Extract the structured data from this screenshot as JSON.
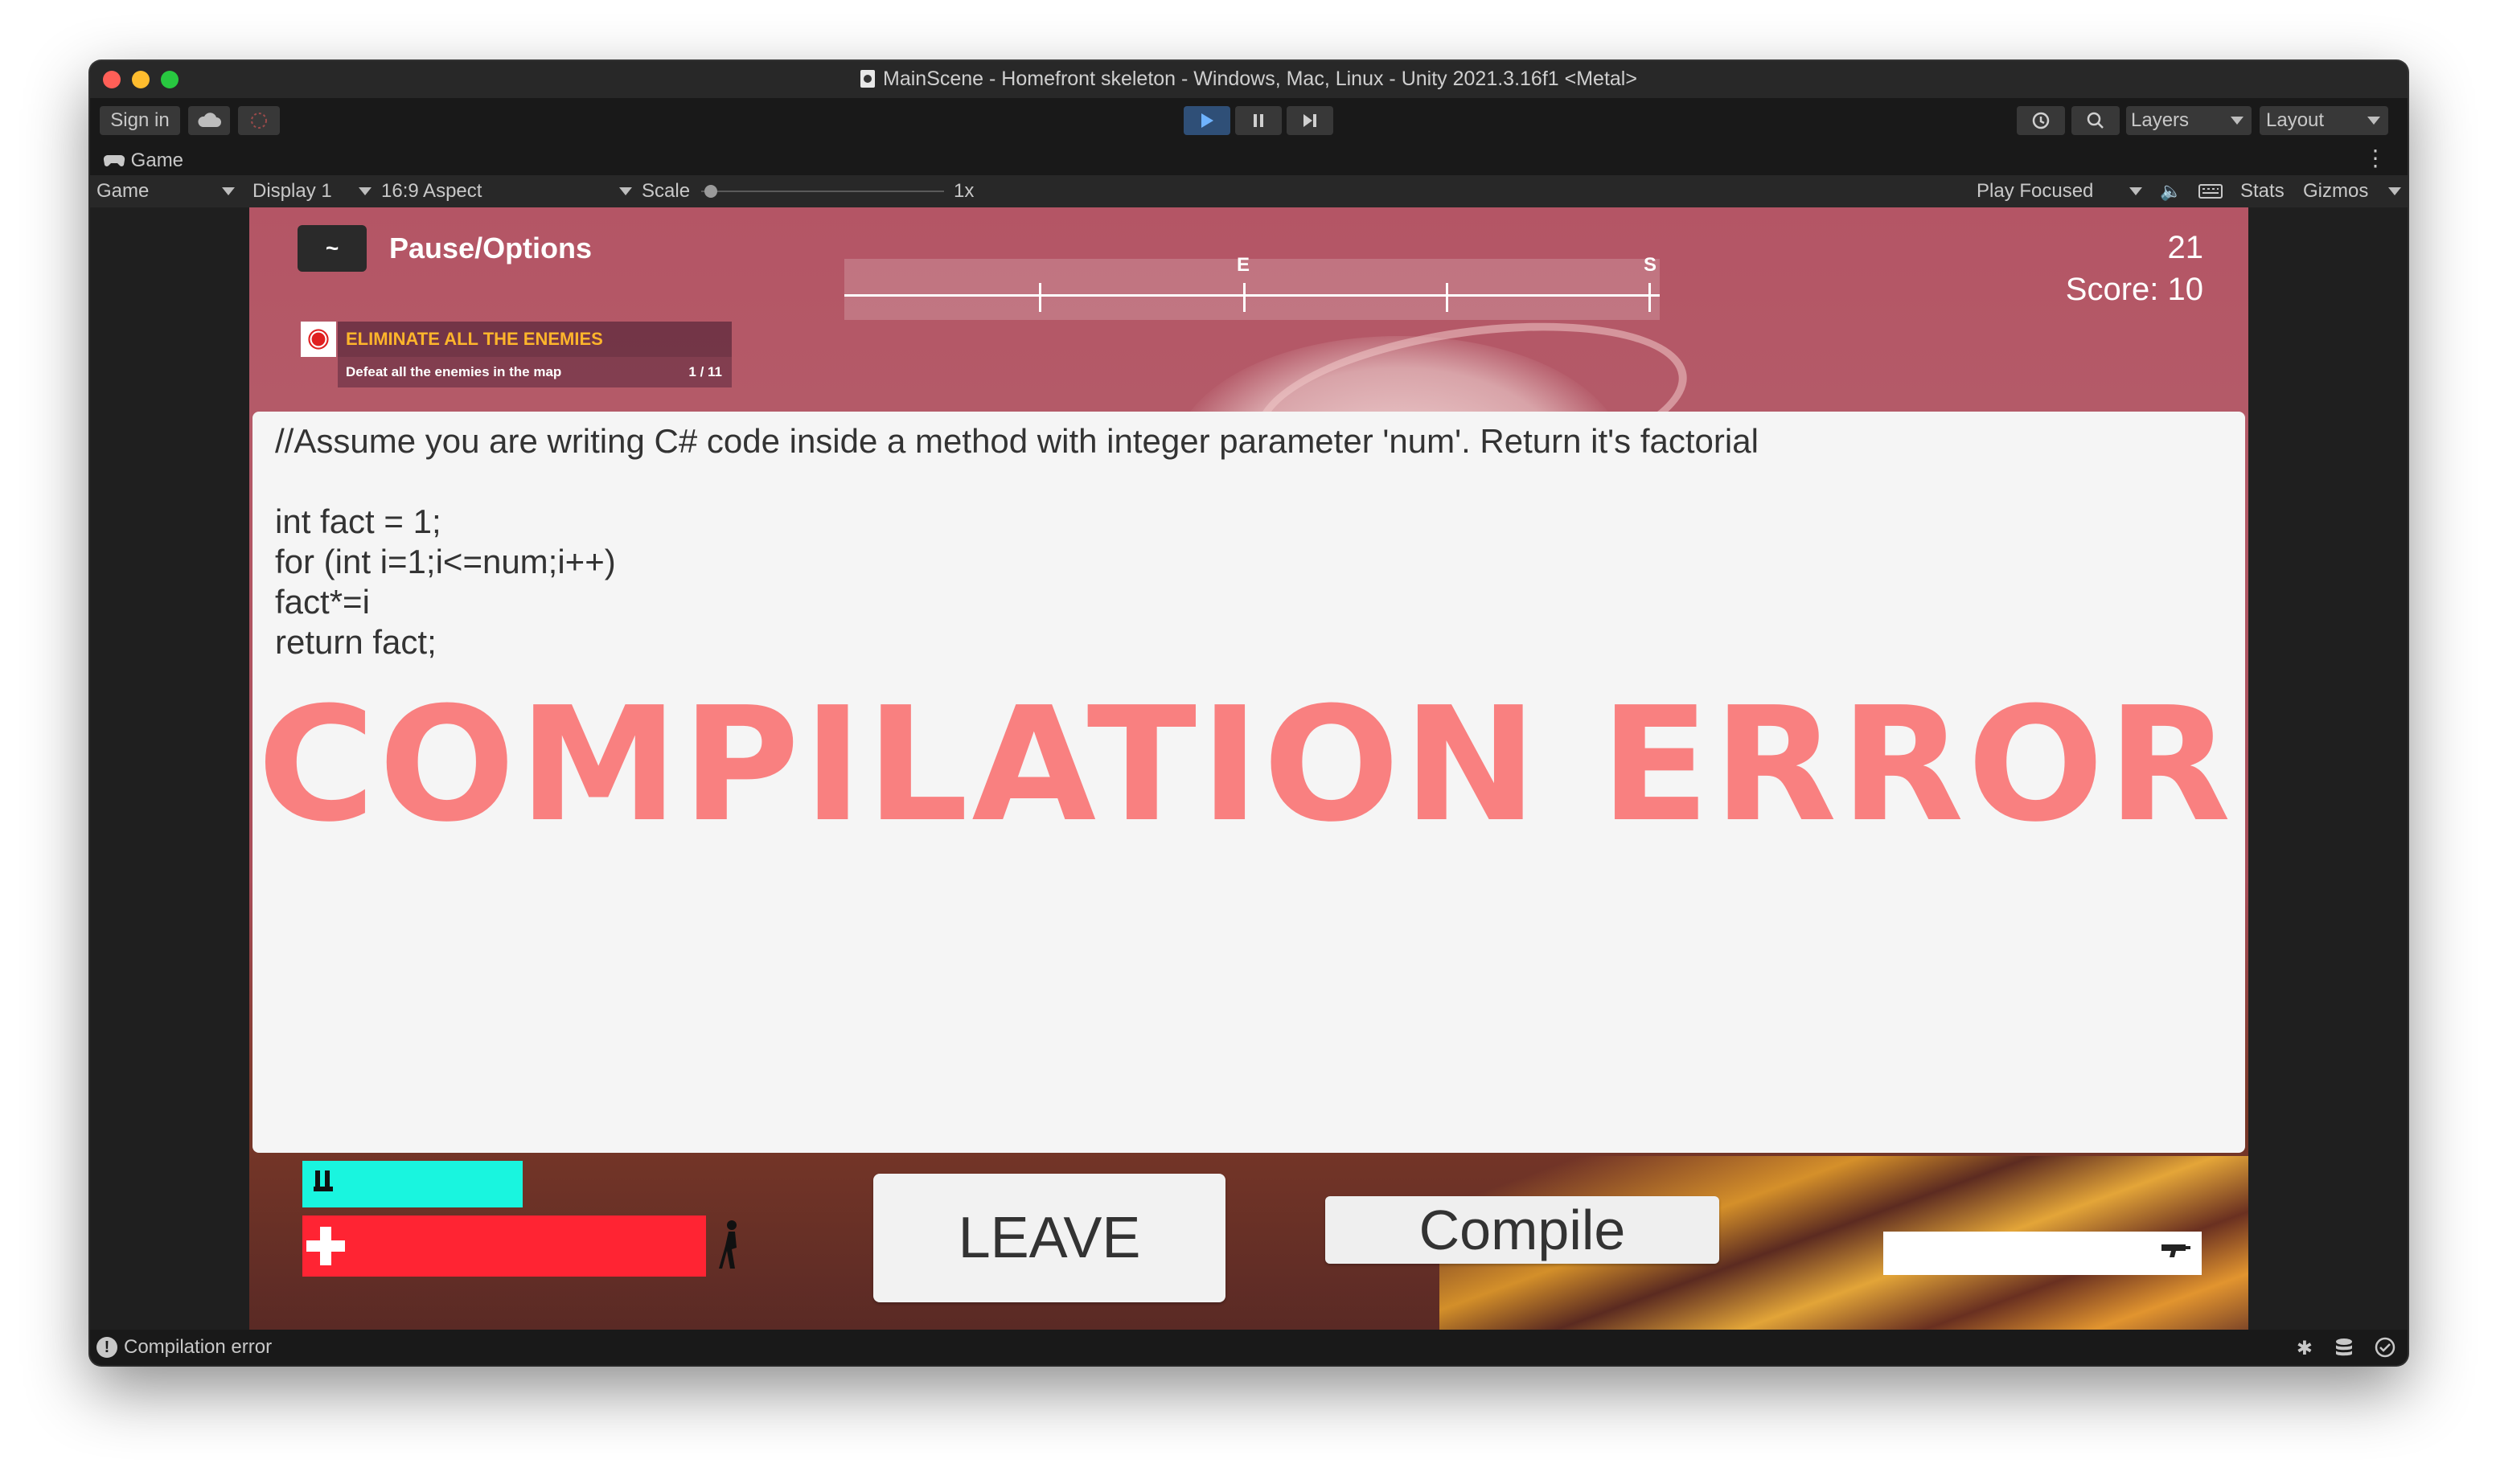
{
  "window": {
    "title": "MainScene - Homefront skeleton - Windows, Mac, Linux - Unity 2021.3.16f1 <Metal>"
  },
  "toolbar": {
    "sign_in": "Sign in",
    "layers": "Layers",
    "layout": "Layout"
  },
  "game_tab": {
    "label": "Game"
  },
  "game_bar": {
    "mode": "Game",
    "display": "Display 1",
    "aspect": "16:9 Aspect",
    "scale_label": "Scale",
    "scale_value": "1x",
    "play_focused": "Play Focused",
    "stats": "Stats",
    "gizmos": "Gizmos"
  },
  "hud": {
    "pause_key": "~",
    "pause_label": "Pause/Options",
    "compass_letters": [
      "E",
      "S"
    ],
    "timer": "21",
    "score": "Score: 10",
    "objective_title": "ELIMINATE ALL THE ENEMIES",
    "objective_sub": "Defeat all the enemies in the map",
    "objective_count": "1 / 11"
  },
  "editor": {
    "comment": "//Assume you are writing C# code inside a method with integer parameter 'num'. Return it's factorial",
    "line1": "int fact = 1;",
    "line2": "for (int i=1;i<=num;i++)",
    "line3": "fact*=i",
    "line4": "return fact;",
    "error_banner": "COMPILATION ERROR"
  },
  "controls": {
    "leave": "LEAVE",
    "compile": "Compile"
  },
  "status": {
    "message": "Compilation error"
  },
  "colors": {
    "stamina_bar": "#19f5df",
    "health_bar": "#ff2433",
    "error_text": "#f98080",
    "objective_title": "#ffb52b"
  }
}
